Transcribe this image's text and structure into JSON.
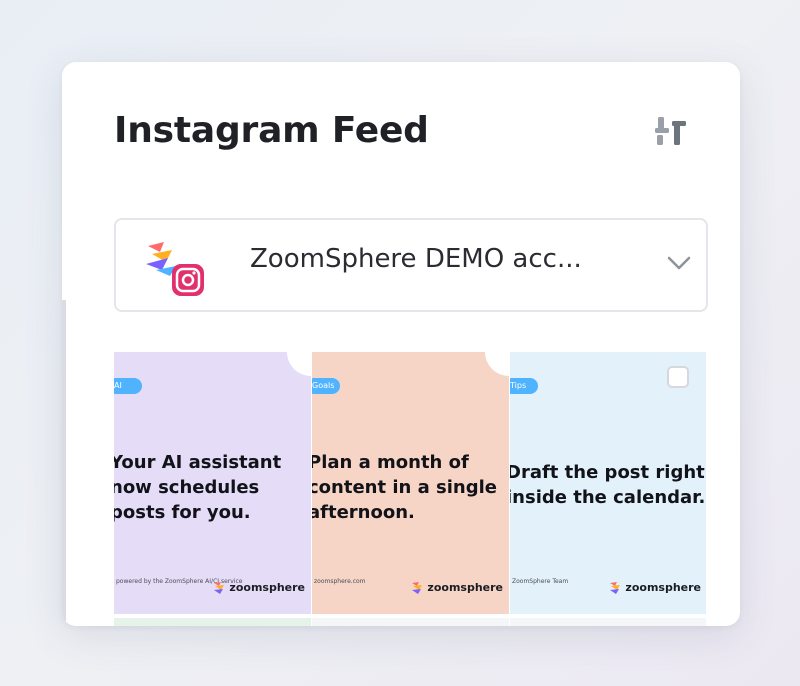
{
  "widget": {
    "title": "Instagram Feed",
    "settings_icon": "sliders-icon"
  },
  "account_selector": {
    "name": "ZoomSphere DEMO acc...",
    "logo": "zoomsphere-instagram-logo",
    "chevron_icon": "chevron-down-icon"
  },
  "posts": [
    {
      "tag": "AI",
      "lines": [
        "Your AI assistant",
        "now schedules",
        "posts for you."
      ],
      "footer": "powered by the ZoomSphere AI/CI service",
      "brand": "zoomsphere",
      "bg": "#e5dcf8"
    },
    {
      "tag": "Goals",
      "lines": [
        "Plan a month of",
        "content in a single",
        "afternoon."
      ],
      "footer": "zoomsphere.com",
      "brand": "zoomsphere",
      "bg": "#f6d4c6"
    },
    {
      "tag": "Tips",
      "lines": [
        "Draft the post right",
        "inside the calendar."
      ],
      "footer": "ZoomSphere Team",
      "brand": "zoomsphere",
      "bg": "#e3f1fb"
    }
  ],
  "colors": {
    "card_bg": "#ffffff",
    "title_text": "#1f2127",
    "tag_blue": "#4fb3ff",
    "post1_bg": "#e5dcf8",
    "post2_bg": "#f6d4c6",
    "post3_bg": "#e3f1fb"
  }
}
